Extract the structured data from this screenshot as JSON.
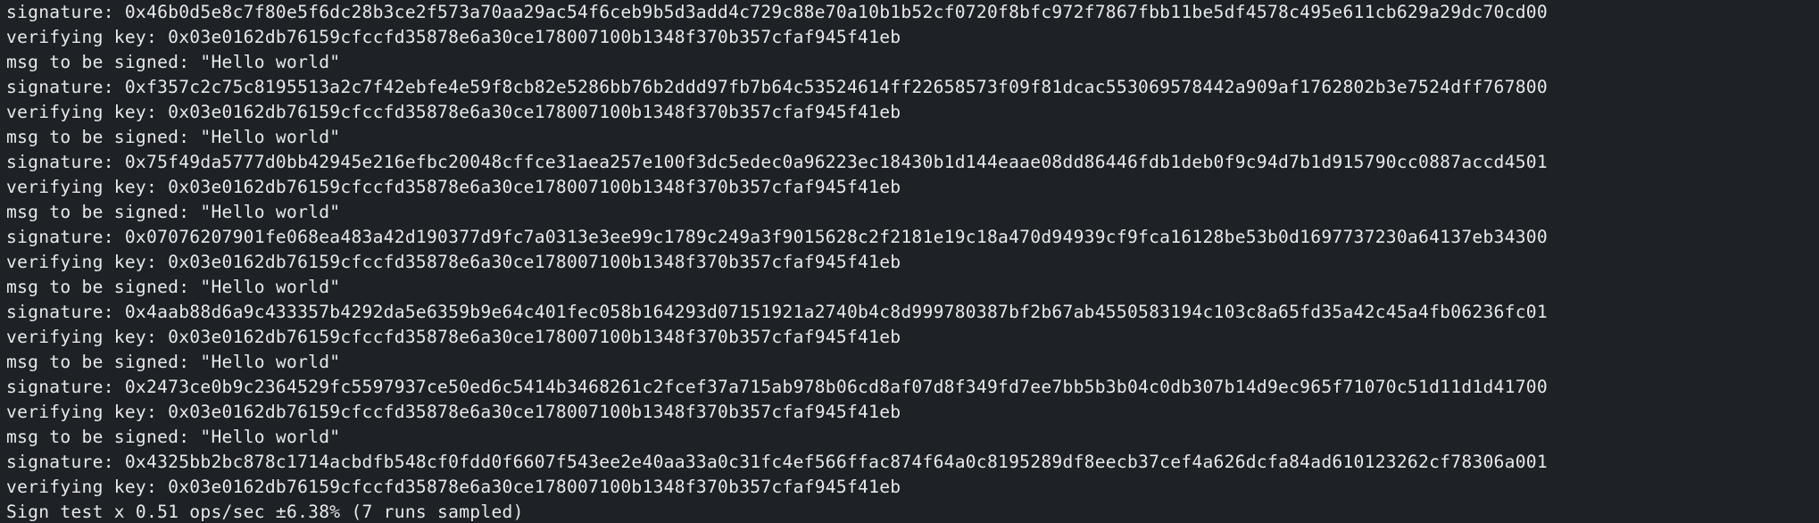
{
  "terminal": {
    "lines": [
      "signature: 0x46b0d5e8c7f80e5f6dc28b3ce2f573a70aa29ac54f6ceb9b5d3add4c729c88e70a10b1b52cf0720f8bfc972f7867fbb11be5df4578c495e611cb629a29dc70cd00",
      "verifying key: 0x03e0162db76159cfccfd35878e6a30ce178007100b1348f370b357cfaf945f41eb",
      "msg to be signed: \"Hello world\"",
      "signature: 0xf357c2c75c8195513a2c7f42ebfe4e59f8cb82e5286bb76b2ddd97fb7b64c53524614ff22658573f09f81dcac553069578442a909af1762802b3e7524dff767800",
      "verifying key: 0x03e0162db76159cfccfd35878e6a30ce178007100b1348f370b357cfaf945f41eb",
      "msg to be signed: \"Hello world\"",
      "signature: 0x75f49da5777d0bb42945e216efbc20048cffce31aea257e100f3dc5edec0a96223ec18430b1d144eaae08dd86446fdb1deb0f9c94d7b1d915790cc0887accd4501",
      "verifying key: 0x03e0162db76159cfccfd35878e6a30ce178007100b1348f370b357cfaf945f41eb",
      "msg to be signed: \"Hello world\"",
      "signature: 0x07076207901fe068ea483a42d190377d9fc7a0313e3ee99c1789c249a3f9015628c2f2181e19c18a470d94939cf9fca16128be53b0d1697737230a64137eb34300",
      "verifying key: 0x03e0162db76159cfccfd35878e6a30ce178007100b1348f370b357cfaf945f41eb",
      "msg to be signed: \"Hello world\"",
      "signature: 0x4aab88d6a9c433357b4292da5e6359b9e64c401fec058b164293d07151921a2740b4c8d999780387bf2b67ab4550583194c103c8a65fd35a42c45a4fb06236fc01",
      "verifying key: 0x03e0162db76159cfccfd35878e6a30ce178007100b1348f370b357cfaf945f41eb",
      "msg to be signed: \"Hello world\"",
      "signature: 0x2473ce0b9c2364529fc5597937ce50ed6c5414b3468261c2fcef37a715ab978b06cd8af07d8f349fd7ee7bb5b3b04c0db307b14d9ec965f71070c51d11d1d41700",
      "verifying key: 0x03e0162db76159cfccfd35878e6a30ce178007100b1348f370b357cfaf945f41eb",
      "msg to be signed: \"Hello world\"",
      "signature: 0x4325bb2bc878c1714acbdfb548cf0fdd0f6607f543ee2e40aa33a0c31fc4ef566ffac874f64a0c8195289df8eecb37cef4a626dcfa84ad610123262cf78306a001",
      "verifying key: 0x03e0162db76159cfccfd35878e6a30ce178007100b1348f370b357cfaf945f41eb",
      "Sign test x 0.51 ops/sec ±6.38% (7 runs sampled)"
    ]
  },
  "colors": {
    "background": "#1e2227",
    "foreground": "#e8e9ea"
  }
}
